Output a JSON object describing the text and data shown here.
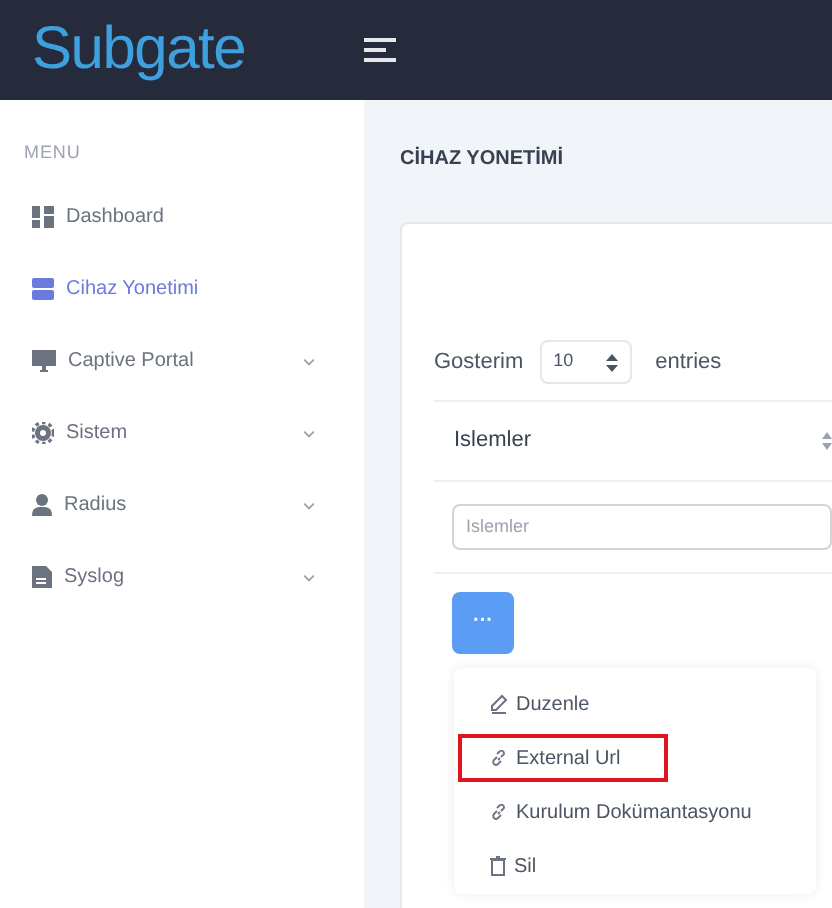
{
  "header": {
    "logo": "Subgate"
  },
  "sidebar": {
    "heading": "MENU",
    "items": [
      {
        "label": "Dashboard",
        "kind": "link",
        "selected": false
      },
      {
        "label": "Cihaz Yonetimi",
        "kind": "link",
        "selected": true
      },
      {
        "label": "Captive Portal",
        "kind": "submenu",
        "selected": false
      },
      {
        "label": "Sistem",
        "kind": "submenu",
        "selected": false
      },
      {
        "label": "Radius",
        "kind": "submenu",
        "selected": false
      },
      {
        "label": "Syslog",
        "kind": "submenu",
        "selected": false
      }
    ]
  },
  "page_title": "CİHAZ YONETİMİ",
  "table": {
    "length_label": "Gosterim",
    "length_value": "10",
    "length_suffix": "entries",
    "columns": [
      "Islemler"
    ],
    "filter": {
      "placeholder": "Islemler"
    },
    "actions_button": "···",
    "menu": [
      {
        "label": "Duzenle",
        "highlighted": false
      },
      {
        "label": "External Url",
        "highlighted": true
      },
      {
        "label": "Kurulum Dokümantasyonu",
        "highlighted": false
      },
      {
        "label": "Sil",
        "highlighted": false
      }
    ]
  }
}
